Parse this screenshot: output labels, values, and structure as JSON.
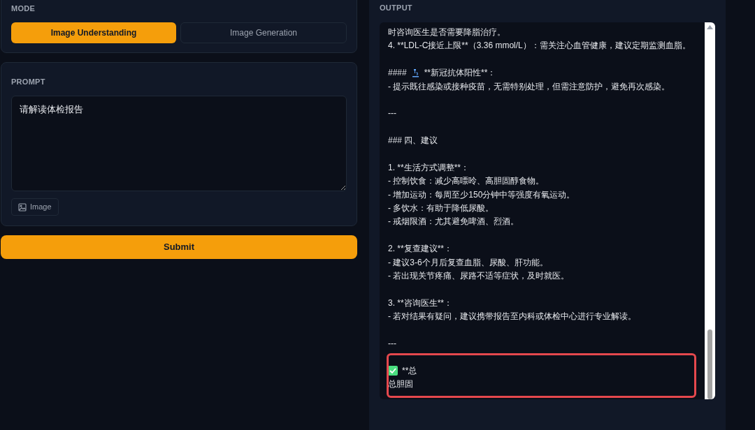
{
  "mode": {
    "label": "MODE",
    "options": [
      {
        "label": "Image Understanding",
        "selected": true
      },
      {
        "label": "Image Generation",
        "selected": false
      }
    ]
  },
  "prompt": {
    "label": "PROMPT",
    "value": "请解读体检报告",
    "attach_button": "Image"
  },
  "submit_button": "Submit",
  "output": {
    "label": "OUTPUT",
    "paragraphs": [
      {
        "lines": [
          {
            "kind": "text",
            "text": "时咨询医生是否需要降脂治疗。"
          },
          {
            "kind": "text",
            "text": "4. **LDL-C接近上限**（3.36 mmol/L）：需关注心血管健康，建议定期监测血脂。"
          }
        ]
      },
      {
        "lines": [
          {
            "kind": "microscope",
            "prefix": "####",
            "text": "**新冠抗体阳性**："
          },
          {
            "kind": "text",
            "text": "- 提示既往感染或接种疫苗，无需特别处理，但需注意防护，避免再次感染。"
          }
        ]
      },
      {
        "lines": [
          {
            "kind": "text",
            "text": "---"
          }
        ]
      },
      {
        "lines": [
          {
            "kind": "text",
            "text": "### 四、建议"
          }
        ]
      },
      {
        "lines": [
          {
            "kind": "text",
            "text": "1. **生活方式调整**："
          },
          {
            "kind": "text",
            "text": "- 控制饮食：减少高嘌呤、高胆固醇食物。"
          },
          {
            "kind": "text",
            "text": "- 增加运动：每周至少150分钟中等强度有氧运动。"
          },
          {
            "kind": "text",
            "text": "- 多饮水：有助于降低尿酸。"
          },
          {
            "kind": "text",
            "text": "- 戒烟限酒：尤其避免啤酒、烈酒。"
          }
        ]
      },
      {
        "lines": [
          {
            "kind": "text",
            "text": "2. **复查建议**："
          },
          {
            "kind": "text",
            "text": "- 建议3-6个月后复查血脂、尿酸、肝功能。"
          },
          {
            "kind": "text",
            "text": "- 若出现关节疼痛、尿路不适等症状，及时就医。"
          }
        ]
      },
      {
        "lines": [
          {
            "kind": "text",
            "text": "3. **咨询医生**："
          },
          {
            "kind": "text",
            "text": "- 若对结果有疑问，建议携带报告至内科或体检中心进行专业解读。"
          }
        ]
      },
      {
        "lines": [
          {
            "kind": "text",
            "text": "---"
          }
        ]
      },
      {
        "lines": [
          {
            "kind": "check",
            "text": "**总"
          },
          {
            "kind": "text",
            "text": "总胆固"
          }
        ]
      }
    ]
  }
}
